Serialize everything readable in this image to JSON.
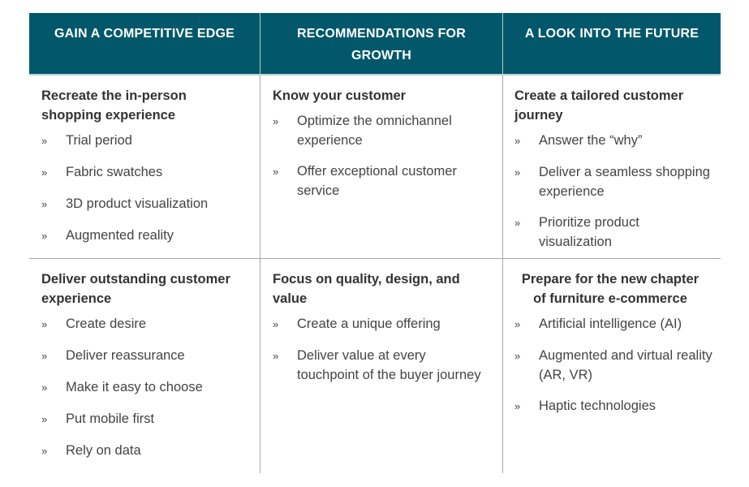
{
  "colors": {
    "header_background": "#02586a",
    "header_text": "#ffffff",
    "divider": "#a9a9a9"
  },
  "bullet_glyph": "»",
  "columns": [
    {
      "header": "GAIN A COMPETITIVE EDGE",
      "cells": [
        {
          "title": "Recreate the in-person shopping experience",
          "items": [
            "Trial period",
            "Fabric swatches",
            "3D product visualization",
            "Augmented reality"
          ]
        },
        {
          "title": "Deliver outstanding customer experience",
          "items": [
            "Create desire",
            "Deliver reassurance",
            "Make it easy to choose",
            "Put mobile first",
            "Rely on data"
          ]
        }
      ]
    },
    {
      "header": "RECOMMENDATIONS FOR GROWTH",
      "cells": [
        {
          "title": "Know your customer",
          "items": [
            "Optimize the omnichannel experience",
            "Offer exceptional customer service"
          ]
        },
        {
          "title": "Focus on quality, design, and value",
          "items": [
            "Create a unique offering",
            "Deliver value at every touchpoint of the buyer journey"
          ]
        }
      ]
    },
    {
      "header": "A LOOK INTO THE FUTURE",
      "cells": [
        {
          "title": "Create a tailored customer journey",
          "items": [
            "Answer the “why”",
            "Deliver a seamless shopping experience",
            "Prioritize product visualization"
          ]
        },
        {
          "title": "Prepare for the new chapter of furniture e-commerce",
          "items": [
            "Artificial intelligence (AI)",
            "Augmented and virtual reality (AR, VR)",
            "Haptic technologies"
          ]
        }
      ]
    }
  ]
}
